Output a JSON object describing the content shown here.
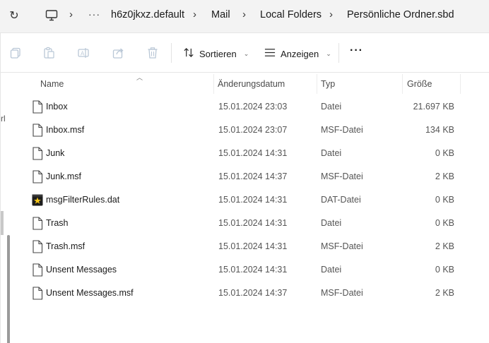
{
  "address_bar": {
    "more": "···",
    "crumbs": [
      "h6z0jkxz.default",
      "Mail",
      "Local Folders",
      "Persönliche Ordner.sbd"
    ],
    "separator": "›"
  },
  "toolbar": {
    "sort_label": "Sortieren",
    "view_label": "Anzeigen",
    "more_label": "···",
    "icons": [
      "copy-icon",
      "paste-icon",
      "rename-icon",
      "share-icon",
      "delete-icon"
    ]
  },
  "nav_edge": {
    "fragment": "rl"
  },
  "columns": {
    "name": "Name",
    "date": "Änderungsdatum",
    "type": "Typ",
    "size": "Größe"
  },
  "files": [
    {
      "name": "Inbox",
      "date": "15.01.2024 23:03",
      "type": "Datei",
      "size": "21.697 KB",
      "icon": "file-icon"
    },
    {
      "name": "Inbox.msf",
      "date": "15.01.2024 23:07",
      "type": "MSF-Datei",
      "size": "134 KB",
      "icon": "file-icon"
    },
    {
      "name": "Junk",
      "date": "15.01.2024 14:31",
      "type": "Datei",
      "size": "0 KB",
      "icon": "file-icon"
    },
    {
      "name": "Junk.msf",
      "date": "15.01.2024 14:37",
      "type": "MSF-Datei",
      "size": "2 KB",
      "icon": "file-icon"
    },
    {
      "name": "msgFilterRules.dat",
      "date": "15.01.2024 14:31",
      "type": "DAT-Datei",
      "size": "0 KB",
      "icon": "dat-file-icon"
    },
    {
      "name": "Trash",
      "date": "15.01.2024 14:31",
      "type": "Datei",
      "size": "0 KB",
      "icon": "file-icon"
    },
    {
      "name": "Trash.msf",
      "date": "15.01.2024 14:31",
      "type": "MSF-Datei",
      "size": "2 KB",
      "icon": "file-icon"
    },
    {
      "name": "Unsent Messages",
      "date": "15.01.2024 14:31",
      "type": "Datei",
      "size": "0 KB",
      "icon": "file-icon"
    },
    {
      "name": "Unsent Messages.msf",
      "date": "15.01.2024 14:37",
      "type": "MSF-Datei",
      "size": "2 KB",
      "icon": "file-icon"
    }
  ]
}
